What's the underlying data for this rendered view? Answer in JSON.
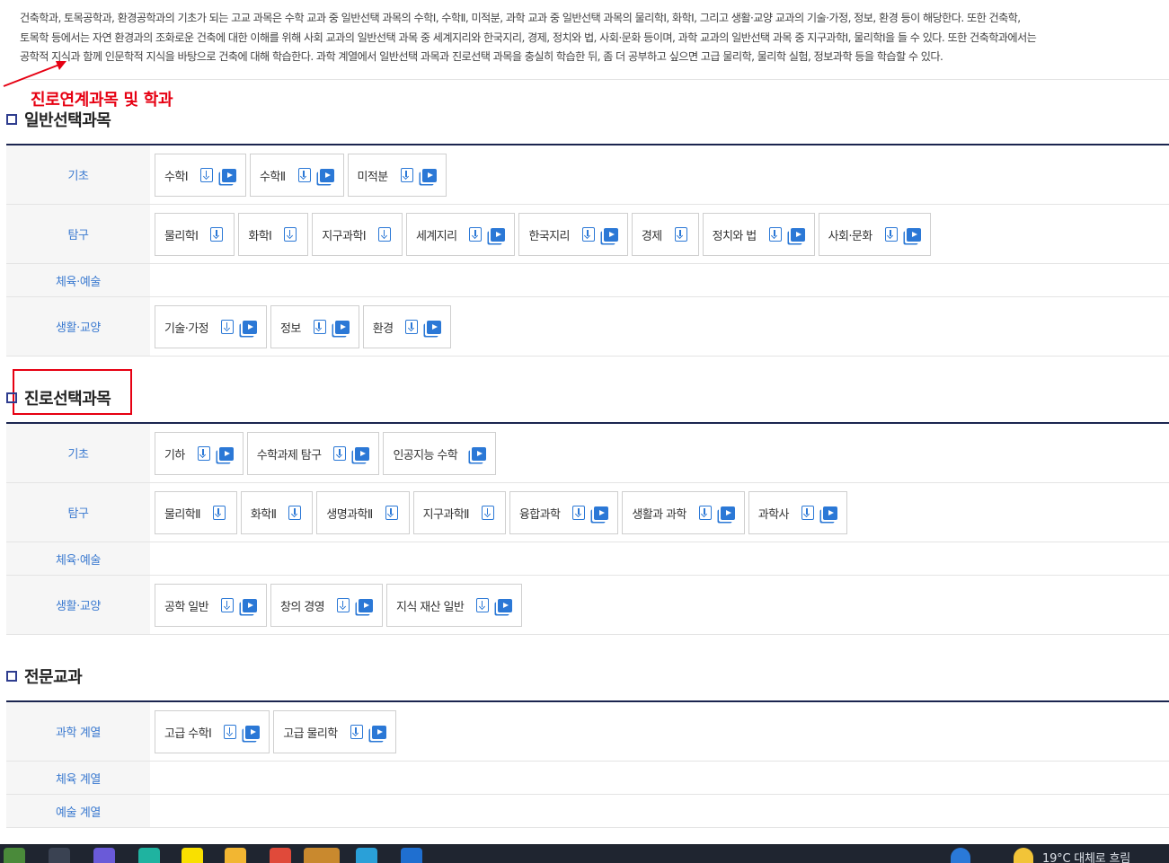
{
  "intro": {
    "lines": [
      "건축학과, 토목공학과, 환경공학과의 기초가 되는 고교 과목은 수학 교과 중 일반선택 과목의 수학Ⅰ, 수학Ⅱ, 미적분, 과학 교과 중 일반선택 과목의 물리학Ⅰ, 화학Ⅰ, 그리고 생활·교양 교과의 기술·가정, 정보, 환경 등이 해당한다. 또한 건축학,",
      "토목학 등에서는 자연 환경과의 조화로운 건축에 대한 이해를 위해 사회 교과의 일반선택 과목 중 세계지리와 한국지리, 경제, 정치와 법, 사회·문화 등이며, 과학 교과의 일반선택 과목 중 지구과학Ⅰ, 물리학Ⅰ을 들 수 있다. 또한 건축학과에서는",
      "공학적 지식과 함께 인문학적 지식을 바탕으로 건축에 대해 학습한다. 과학 계열에서 일반선택 과목과 진로선택 과목을 충실히 학습한 뒤, 좀 더 공부하고 싶으면 고급 물리학, 물리학 실험, 정보과학 등을 학습할 수 있다."
    ]
  },
  "annotation": {
    "text": "진로연계과목 및 학과",
    "color": "#e60012"
  },
  "sections": [
    {
      "title": "일반선택과목",
      "rows": [
        {
          "label": "기초",
          "chips": [
            {
              "label": "수학Ⅰ",
              "download": true,
              "video": true
            },
            {
              "label": "수학Ⅱ",
              "download": true,
              "video": true
            },
            {
              "label": "미적분",
              "download": true,
              "video": true
            }
          ]
        },
        {
          "label": "탐구",
          "chips": [
            {
              "label": "물리학Ⅰ",
              "download": true,
              "video": false
            },
            {
              "label": "화학Ⅰ",
              "download": true,
              "video": false
            },
            {
              "label": "지구과학Ⅰ",
              "download": true,
              "video": false
            },
            {
              "label": "세계지리",
              "download": true,
              "video": true
            },
            {
              "label": "한국지리",
              "download": true,
              "video": true
            },
            {
              "label": "경제",
              "download": true,
              "video": false
            },
            {
              "label": "정치와 법",
              "download": true,
              "video": true
            },
            {
              "label": "사회·문화",
              "download": true,
              "video": true
            }
          ]
        },
        {
          "label": "체육·예술",
          "chips": []
        },
        {
          "label": "생활·교양",
          "chips": [
            {
              "label": "기술·가정",
              "download": true,
              "video": true
            },
            {
              "label": "정보",
              "download": true,
              "video": true
            },
            {
              "label": "환경",
              "download": true,
              "video": true
            }
          ]
        }
      ]
    },
    {
      "title": "진로선택과목",
      "rows": [
        {
          "label": "기초",
          "chips": [
            {
              "label": "기하",
              "download": true,
              "video": true
            },
            {
              "label": "수학과제 탐구",
              "download": true,
              "video": true
            },
            {
              "label": "인공지능 수학",
              "download": false,
              "video": true
            }
          ]
        },
        {
          "label": "탐구",
          "chips": [
            {
              "label": "물리학Ⅱ",
              "download": true,
              "video": false
            },
            {
              "label": "화학Ⅱ",
              "download": true,
              "video": false
            },
            {
              "label": "생명과학Ⅱ",
              "download": true,
              "video": false
            },
            {
              "label": "지구과학Ⅱ",
              "download": true,
              "video": false
            },
            {
              "label": "융합과학",
              "download": true,
              "video": true
            },
            {
              "label": "생활과 과학",
              "download": true,
              "video": true
            },
            {
              "label": "과학사",
              "download": true,
              "video": true
            }
          ]
        },
        {
          "label": "체육·예술",
          "chips": []
        },
        {
          "label": "생활·교양",
          "chips": [
            {
              "label": "공학 일반",
              "download": true,
              "video": true
            },
            {
              "label": "창의 경영",
              "download": true,
              "video": true
            },
            {
              "label": "지식 재산 일반",
              "download": true,
              "video": true
            }
          ]
        }
      ]
    },
    {
      "title": "전문교과",
      "rows": [
        {
          "label": "과학 계열",
          "chips": [
            {
              "label": "고급 수학Ⅰ",
              "download": true,
              "video": true
            },
            {
              "label": "고급 물리학",
              "download": true,
              "video": true
            }
          ]
        },
        {
          "label": "체육 계열",
          "chips": []
        },
        {
          "label": "예술 계열",
          "chips": []
        }
      ]
    }
  ],
  "taskbar": {
    "weather": "19°C 대체로 흐림"
  },
  "colors": {
    "accent": "#2b78d6",
    "head_text": "#3b7ad0",
    "table_top": "#1b2550",
    "section_square": "#2f3d8f"
  }
}
